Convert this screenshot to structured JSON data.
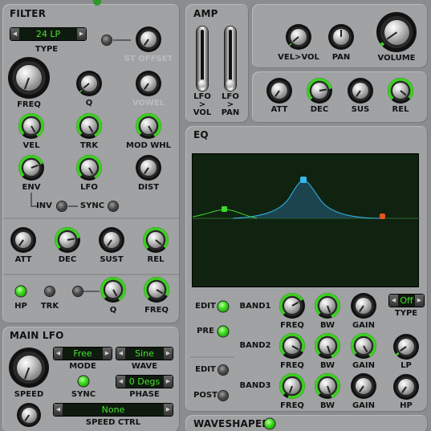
{
  "filter": {
    "title": "FILTER",
    "type_value": "24 LP",
    "type_label": "TYPE",
    "st_offset_label": "ST OFFSET",
    "freq_label": "FREQ",
    "q_label": "Q",
    "vowel_label": "VOWEL",
    "vel_label": "VEL",
    "trk_label": "TRK",
    "mod_whl_label": "MOD WHL",
    "env_label": "ENV",
    "lfo_label": "LFO",
    "dist_label": "DIST",
    "inv_label": "INV",
    "sync_label": "SYNC",
    "att_label": "ATT",
    "dec_label": "DEC",
    "sust_label": "SUST",
    "rel_label": "REL",
    "hp_label": "HP",
    "trk2_label": "TRK",
    "q2_label": "Q",
    "freq2_label": "FREQ"
  },
  "main_lfo": {
    "title": "MAIN LFO",
    "speed_label": "SPEED",
    "mode_value": "Free",
    "mode_label": "MODE",
    "wave_value": "Sine",
    "wave_label": "WAVE",
    "sync_label": "SYNC",
    "phase_value": "0 Degs",
    "phase_label": "PHASE",
    "speed_ctrl_value": "None",
    "speed_ctrl_label": "SPEED CTRL"
  },
  "amp": {
    "title": "AMP",
    "lfo_vol_label": "LFO\n>\nVOL",
    "lfo_pan_label": "LFO\n>\nPAN",
    "vel_vol_label": "VEL>VOL",
    "pan_label": "PAN",
    "volume_label": "VOLUME",
    "att_label": "ATT",
    "dec_label": "DEC",
    "sus_label": "SUS",
    "rel_label": "REL"
  },
  "eq": {
    "title": "EQ",
    "edit1_label": "EDIT",
    "pre_label": "PRE",
    "edit2_label": "EDIT",
    "post_label": "POST",
    "band1_label": "BAND1",
    "band2_label": "BAND2",
    "band3_label": "BAND3",
    "freq_label": "FREQ",
    "bw_label": "BW",
    "gain_label": "GAIN",
    "type_value": "Off",
    "type_label": "TYPE",
    "lp_label": "LP",
    "hp_label": "HP",
    "colors": {
      "screen": "#102210",
      "band1": "#3cd82a",
      "band2": "#33b9ee",
      "band3": "#e2561c"
    }
  },
  "waveshaper": {
    "title": "WAVESHAPER"
  },
  "colors": {
    "accent": "#3cd020",
    "panel": "#a0a2a4",
    "display_text": "#45e52a"
  }
}
